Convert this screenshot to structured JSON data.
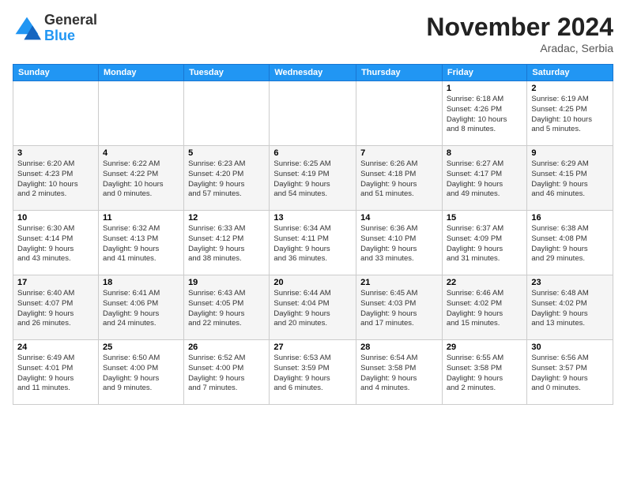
{
  "header": {
    "logo_general": "General",
    "logo_blue": "Blue",
    "month_title": "November 2024",
    "location": "Aradac, Serbia"
  },
  "weekdays": [
    "Sunday",
    "Monday",
    "Tuesday",
    "Wednesday",
    "Thursday",
    "Friday",
    "Saturday"
  ],
  "weeks": [
    [
      {
        "day": "",
        "info": ""
      },
      {
        "day": "",
        "info": ""
      },
      {
        "day": "",
        "info": ""
      },
      {
        "day": "",
        "info": ""
      },
      {
        "day": "",
        "info": ""
      },
      {
        "day": "1",
        "info": "Sunrise: 6:18 AM\nSunset: 4:26 PM\nDaylight: 10 hours\nand 8 minutes."
      },
      {
        "day": "2",
        "info": "Sunrise: 6:19 AM\nSunset: 4:25 PM\nDaylight: 10 hours\nand 5 minutes."
      }
    ],
    [
      {
        "day": "3",
        "info": "Sunrise: 6:20 AM\nSunset: 4:23 PM\nDaylight: 10 hours\nand 2 minutes."
      },
      {
        "day": "4",
        "info": "Sunrise: 6:22 AM\nSunset: 4:22 PM\nDaylight: 10 hours\nand 0 minutes."
      },
      {
        "day": "5",
        "info": "Sunrise: 6:23 AM\nSunset: 4:20 PM\nDaylight: 9 hours\nand 57 minutes."
      },
      {
        "day": "6",
        "info": "Sunrise: 6:25 AM\nSunset: 4:19 PM\nDaylight: 9 hours\nand 54 minutes."
      },
      {
        "day": "7",
        "info": "Sunrise: 6:26 AM\nSunset: 4:18 PM\nDaylight: 9 hours\nand 51 minutes."
      },
      {
        "day": "8",
        "info": "Sunrise: 6:27 AM\nSunset: 4:17 PM\nDaylight: 9 hours\nand 49 minutes."
      },
      {
        "day": "9",
        "info": "Sunrise: 6:29 AM\nSunset: 4:15 PM\nDaylight: 9 hours\nand 46 minutes."
      }
    ],
    [
      {
        "day": "10",
        "info": "Sunrise: 6:30 AM\nSunset: 4:14 PM\nDaylight: 9 hours\nand 43 minutes."
      },
      {
        "day": "11",
        "info": "Sunrise: 6:32 AM\nSunset: 4:13 PM\nDaylight: 9 hours\nand 41 minutes."
      },
      {
        "day": "12",
        "info": "Sunrise: 6:33 AM\nSunset: 4:12 PM\nDaylight: 9 hours\nand 38 minutes."
      },
      {
        "day": "13",
        "info": "Sunrise: 6:34 AM\nSunset: 4:11 PM\nDaylight: 9 hours\nand 36 minutes."
      },
      {
        "day": "14",
        "info": "Sunrise: 6:36 AM\nSunset: 4:10 PM\nDaylight: 9 hours\nand 33 minutes."
      },
      {
        "day": "15",
        "info": "Sunrise: 6:37 AM\nSunset: 4:09 PM\nDaylight: 9 hours\nand 31 minutes."
      },
      {
        "day": "16",
        "info": "Sunrise: 6:38 AM\nSunset: 4:08 PM\nDaylight: 9 hours\nand 29 minutes."
      }
    ],
    [
      {
        "day": "17",
        "info": "Sunrise: 6:40 AM\nSunset: 4:07 PM\nDaylight: 9 hours\nand 26 minutes."
      },
      {
        "day": "18",
        "info": "Sunrise: 6:41 AM\nSunset: 4:06 PM\nDaylight: 9 hours\nand 24 minutes."
      },
      {
        "day": "19",
        "info": "Sunrise: 6:43 AM\nSunset: 4:05 PM\nDaylight: 9 hours\nand 22 minutes."
      },
      {
        "day": "20",
        "info": "Sunrise: 6:44 AM\nSunset: 4:04 PM\nDaylight: 9 hours\nand 20 minutes."
      },
      {
        "day": "21",
        "info": "Sunrise: 6:45 AM\nSunset: 4:03 PM\nDaylight: 9 hours\nand 17 minutes."
      },
      {
        "day": "22",
        "info": "Sunrise: 6:46 AM\nSunset: 4:02 PM\nDaylight: 9 hours\nand 15 minutes."
      },
      {
        "day": "23",
        "info": "Sunrise: 6:48 AM\nSunset: 4:02 PM\nDaylight: 9 hours\nand 13 minutes."
      }
    ],
    [
      {
        "day": "24",
        "info": "Sunrise: 6:49 AM\nSunset: 4:01 PM\nDaylight: 9 hours\nand 11 minutes."
      },
      {
        "day": "25",
        "info": "Sunrise: 6:50 AM\nSunset: 4:00 PM\nDaylight: 9 hours\nand 9 minutes."
      },
      {
        "day": "26",
        "info": "Sunrise: 6:52 AM\nSunset: 4:00 PM\nDaylight: 9 hours\nand 7 minutes."
      },
      {
        "day": "27",
        "info": "Sunrise: 6:53 AM\nSunset: 3:59 PM\nDaylight: 9 hours\nand 6 minutes."
      },
      {
        "day": "28",
        "info": "Sunrise: 6:54 AM\nSunset: 3:58 PM\nDaylight: 9 hours\nand 4 minutes."
      },
      {
        "day": "29",
        "info": "Sunrise: 6:55 AM\nSunset: 3:58 PM\nDaylight: 9 hours\nand 2 minutes."
      },
      {
        "day": "30",
        "info": "Sunrise: 6:56 AM\nSunset: 3:57 PM\nDaylight: 9 hours\nand 0 minutes."
      }
    ]
  ]
}
